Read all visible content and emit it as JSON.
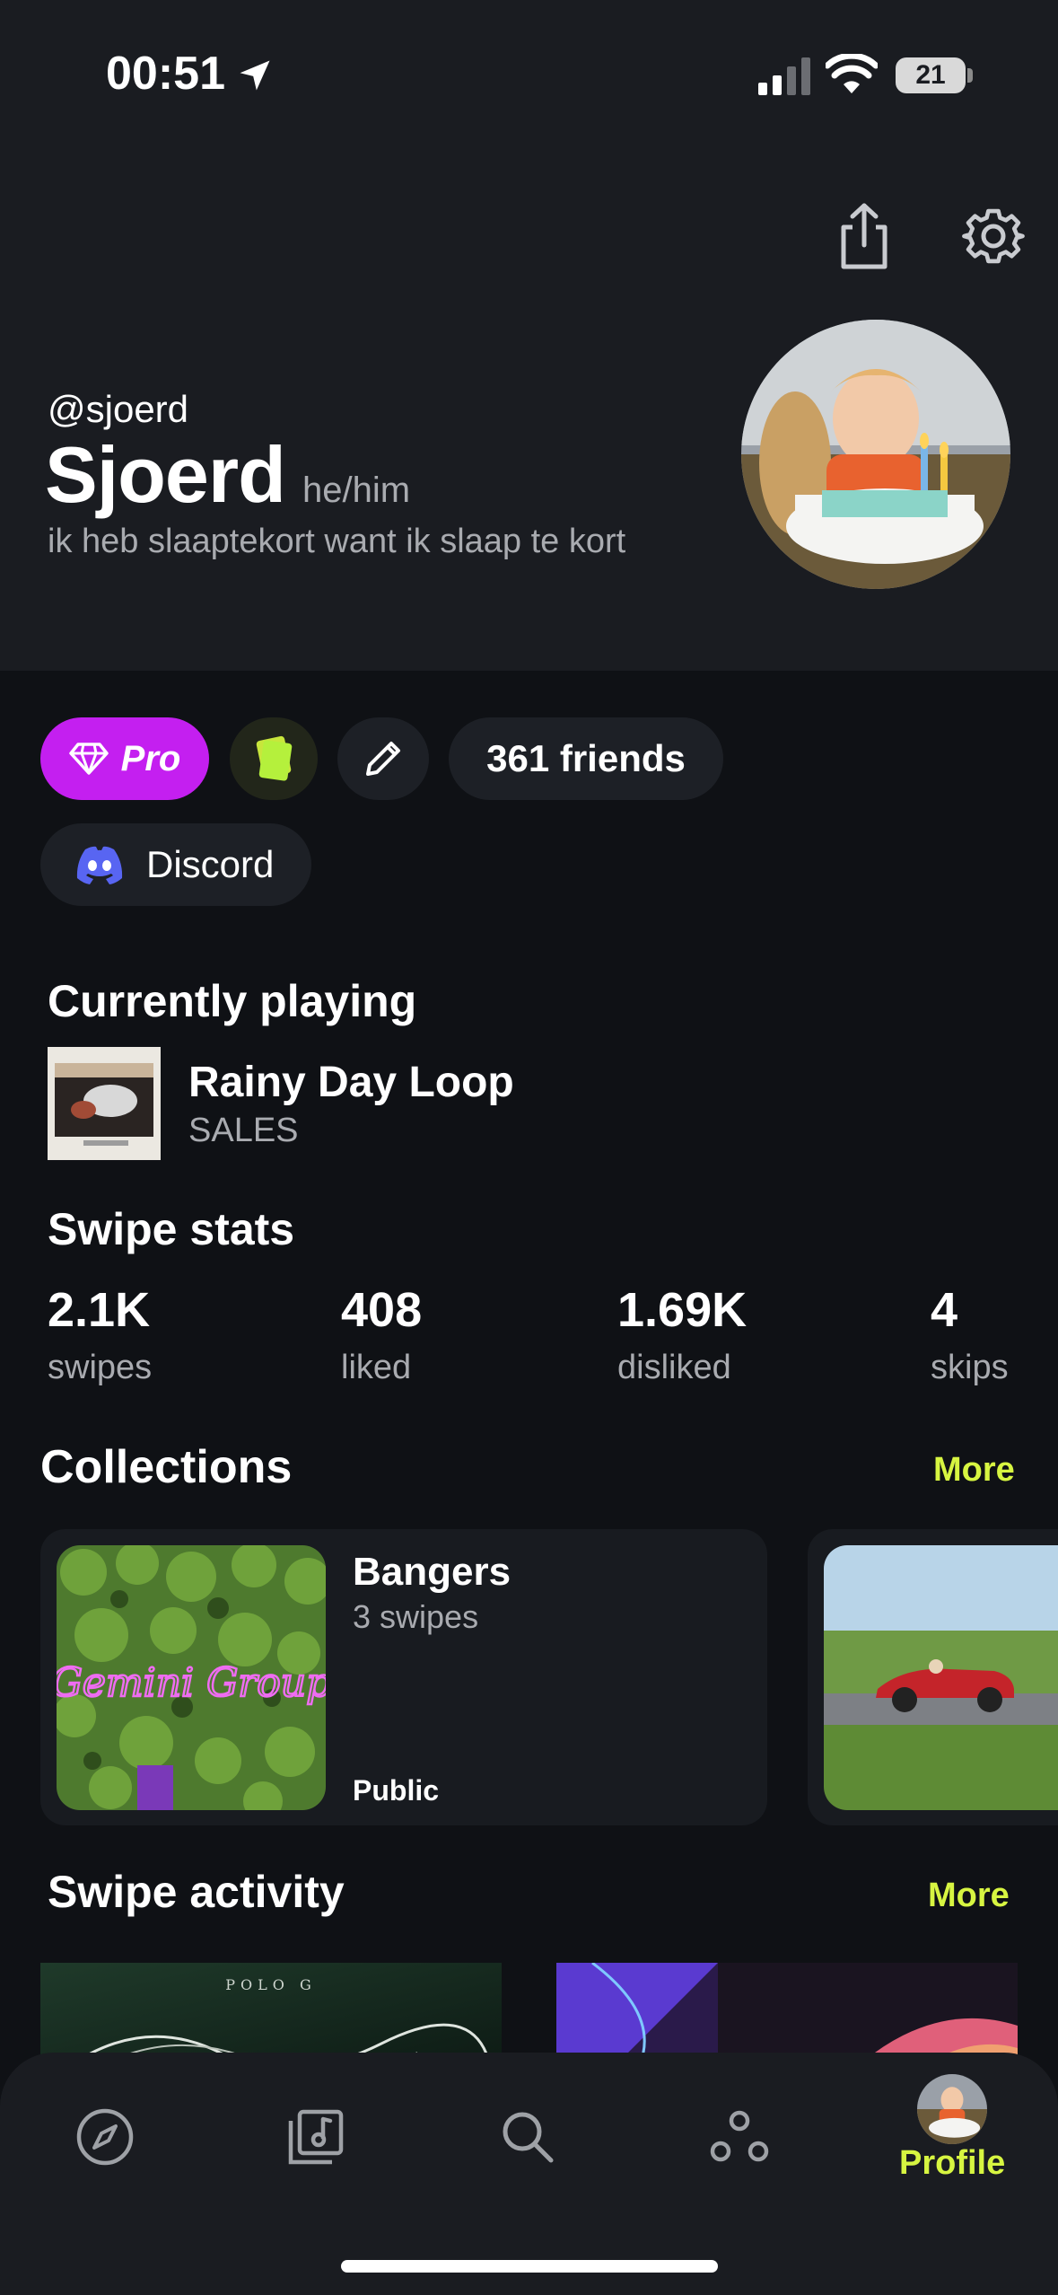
{
  "status_bar": {
    "time": "00:51",
    "battery": "21"
  },
  "profile": {
    "handle": "@sjoerd",
    "name": "Sjoerd",
    "pronouns": "he/him",
    "bio": "ik heb slaaptekort want ik slaap te kort"
  },
  "chips": {
    "pro": "Pro",
    "friends": "361 friends",
    "discord": "Discord"
  },
  "now_playing": {
    "heading": "Currently playing",
    "title": "Rainy Day Loop",
    "artist": "SALES"
  },
  "swipe_stats": {
    "heading": "Swipe stats",
    "items": [
      {
        "value": "2.1K",
        "label": "swipes"
      },
      {
        "value": "408",
        "label": "liked"
      },
      {
        "value": "1.69K",
        "label": "disliked"
      },
      {
        "value": "4",
        "label": "skips"
      }
    ]
  },
  "collections": {
    "heading": "Collections",
    "more": "More",
    "items": [
      {
        "name": "Bangers",
        "count": "3 swipes",
        "visibility": "Public",
        "art_text": "Gemini Group"
      }
    ]
  },
  "swipe_activity": {
    "heading": "Swipe activity",
    "more": "More",
    "card1_top_text": "POLO G"
  },
  "tabbar": {
    "profile_label": "Profile"
  },
  "colors": {
    "accent": "#d7f541",
    "pro": "#c41ff0",
    "discord": "#5865f2",
    "background": "#0f1115"
  }
}
